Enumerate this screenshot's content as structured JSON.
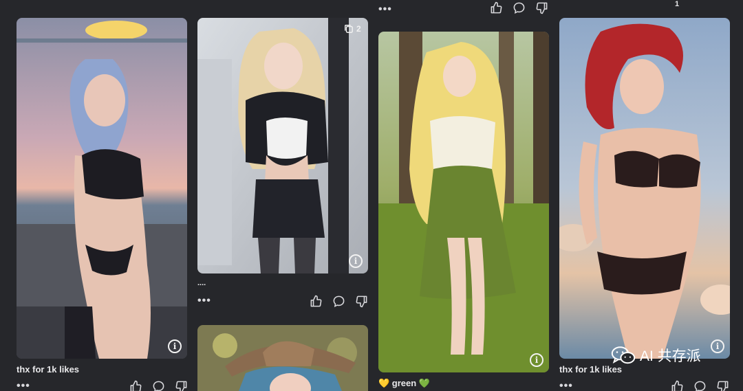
{
  "cards": [
    {
      "caption": "thx for 1k likes",
      "info_glyph": "i"
    },
    {
      "caption": "....",
      "info_glyph": "i",
      "image_count": "2"
    },
    {
      "caption": "💛 green 💚",
      "info_glyph": "i"
    },
    {
      "caption": "thx for 1k likes",
      "info_glyph": "i"
    }
  ],
  "menu_dots": "•••",
  "top_counter": "1",
  "watermark": {
    "text": "AI 共存派",
    "icon": "wechat-icon"
  },
  "colors": {
    "background": "#26272b",
    "text": "#e8e8ea"
  }
}
